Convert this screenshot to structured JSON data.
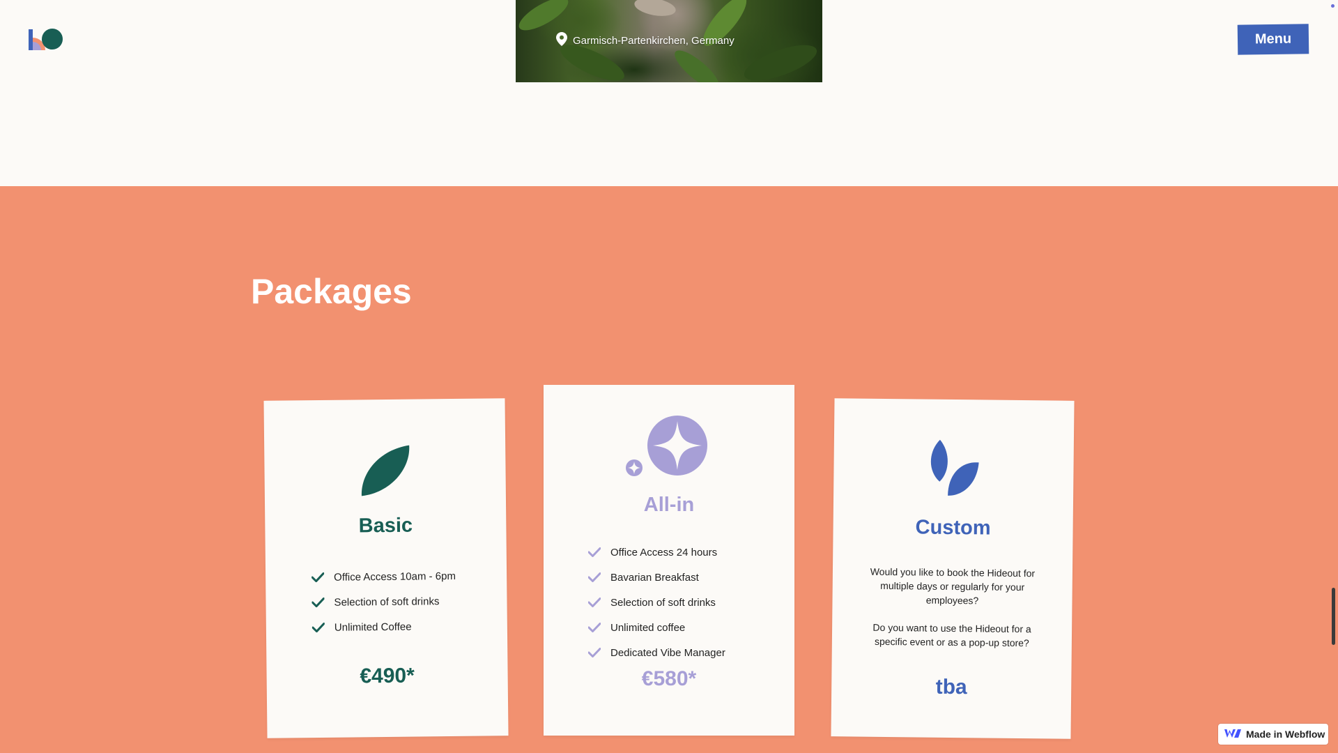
{
  "header": {
    "logo_icon": "ko-logo-icon",
    "location_icon": "map-pin-icon",
    "location": "Garmisch-Partenkirchen, Germany",
    "menu_label": "Menu"
  },
  "packages": {
    "heading": "Packages",
    "cards": [
      {
        "icon": "leaf-icon",
        "title": "Basic",
        "features": [
          "Office Access 10am - 6pm",
          "Selection of soft drinks",
          "Unlimited Coffee"
        ],
        "price": "€490*"
      },
      {
        "icon": "sparkle-icon",
        "title": "All-in",
        "features": [
          "Office Access 24 hours",
          "Bavarian Breakfast",
          "Selection of soft drinks",
          "Unlimited coffee",
          "Dedicated Vibe Manager"
        ],
        "price": "€580*"
      },
      {
        "icon": "two-leaves-icon",
        "title": "Custom",
        "description_1": "Would you like to book the Hideout for multiple days or regularly for your employees?",
        "description_2": "Do you want to use the Hideout for a specific event or as a pop-up store?",
        "price": "tba"
      }
    ]
  },
  "badge": {
    "label": "Made in Webflow",
    "icon": "webflow-icon"
  },
  "colors": {
    "section_bg": "#f29170",
    "page_bg": "#fcfaf7",
    "basic": "#185e54",
    "allin": "#a79fd6",
    "custom": "#3f63b8",
    "menu_button": "#3f63b8"
  }
}
